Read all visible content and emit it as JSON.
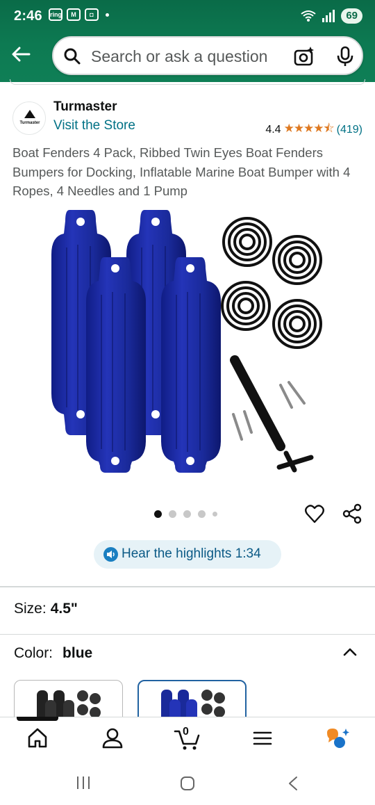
{
  "status_bar": {
    "time": "2:46",
    "battery": "69"
  },
  "search": {
    "placeholder": "Search or ask a question"
  },
  "brand": {
    "name": "Turmaster",
    "logo_text": "Turmaster",
    "visit_link": "Visit the Store"
  },
  "rating": {
    "value": "4.4",
    "stars": "★★★★⯪",
    "count": "(419)"
  },
  "product": {
    "title": "Boat Fenders 4 Pack, Ribbed Twin Eyes Boat Fenders Bumpers for Docking, Inflatable Marine Boat Bumper with 4 Ropes, 4 Needles and 1 Pump",
    "image_index": 1,
    "image_count": 5
  },
  "hear_highlights": {
    "label": "Hear the highlights 1:34"
  },
  "size": {
    "label": "Size:",
    "value": "4.5\""
  },
  "color": {
    "label": "Color:",
    "value": "blue"
  },
  "colors": {
    "fender_blue": "#1a2a9a",
    "accent_green": "#0a6b48",
    "link": "#007185",
    "star": "#de7921"
  },
  "bottom_nav": {
    "cart_count": "0"
  }
}
